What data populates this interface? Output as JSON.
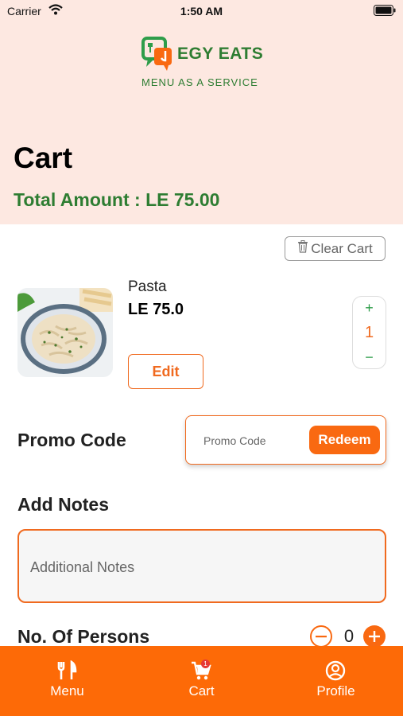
{
  "status_bar": {
    "carrier": "Carrier",
    "time": "1:50 AM"
  },
  "brand": {
    "name": "EGY EATS",
    "tagline": "MENU AS A SERVICE",
    "primary_color": "#fd6a07",
    "green_color": "#2e7d32"
  },
  "page": {
    "title": "Cart",
    "total_label": "Total Amount : LE 75.00"
  },
  "cart": {
    "clear_label": "Clear Cart",
    "items": [
      {
        "name": "Pasta",
        "price": "LE 75.0",
        "quantity": "1",
        "edit_label": "Edit",
        "image": "pasta-dish"
      }
    ]
  },
  "promo": {
    "label": "Promo Code",
    "placeholder": "Promo Code",
    "redeem_label": "Redeem"
  },
  "notes": {
    "label": "Add Notes",
    "placeholder": "Additional Notes"
  },
  "persons": {
    "label": "No. Of Persons",
    "count": "0"
  },
  "tabs": [
    {
      "label": "Menu",
      "icon": "fork-knife-icon"
    },
    {
      "label": "Cart",
      "icon": "cart-icon",
      "badge": "1"
    },
    {
      "label": "Profile",
      "icon": "user-circle-icon"
    }
  ]
}
